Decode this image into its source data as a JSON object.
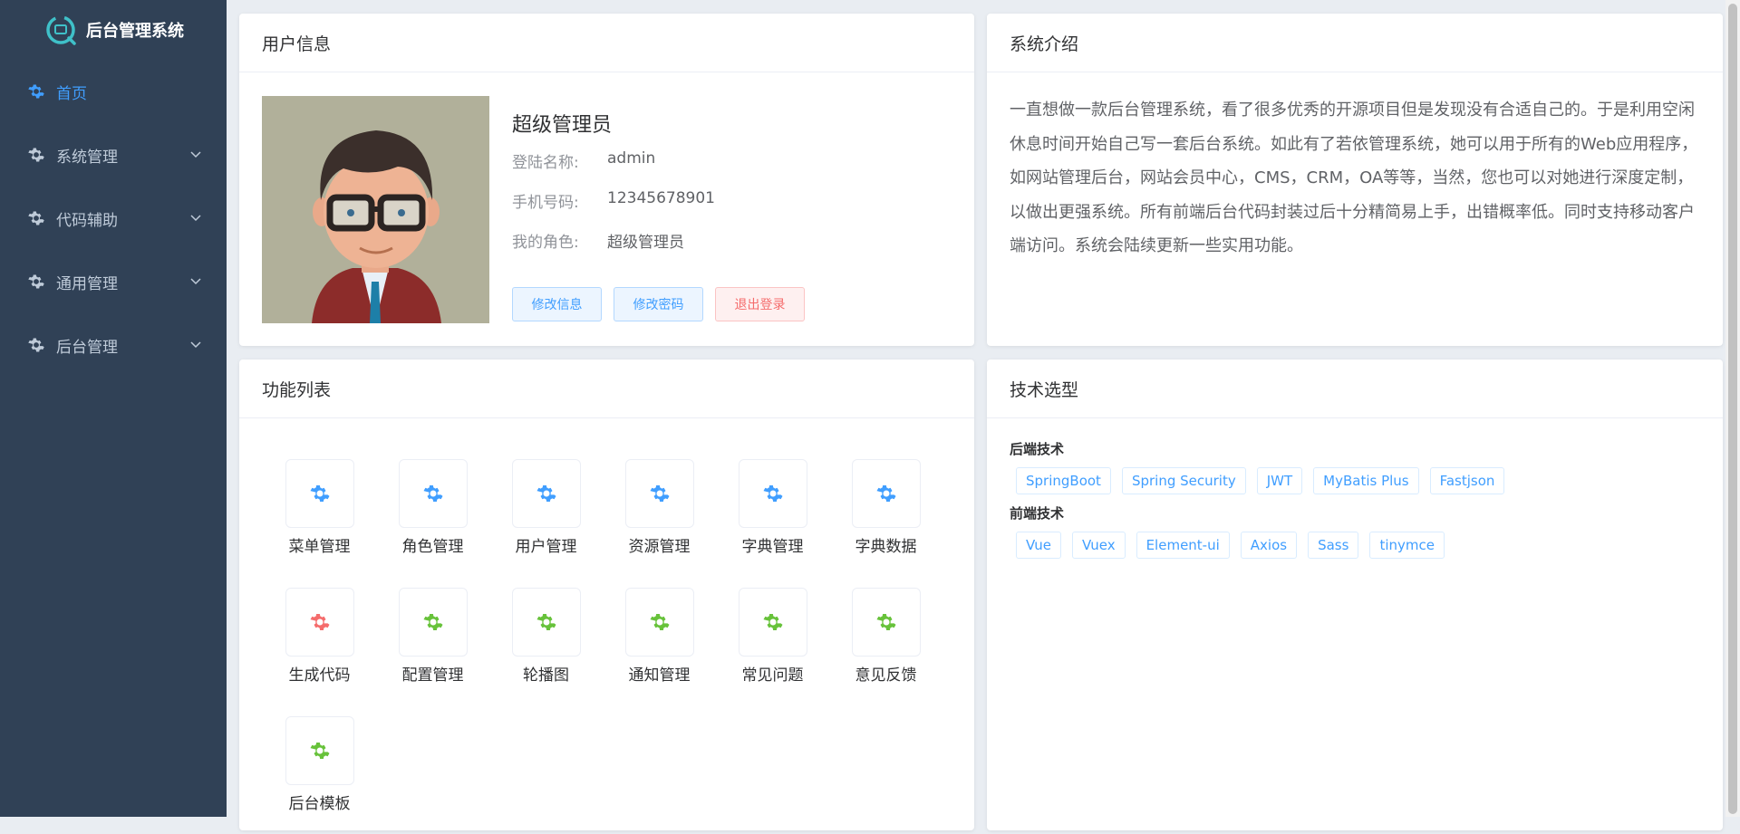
{
  "app": {
    "title": "后台管理系统"
  },
  "sidebar": {
    "items": [
      {
        "label": "首页",
        "active": true,
        "has_children": false
      },
      {
        "label": "系统管理",
        "active": false,
        "has_children": true
      },
      {
        "label": "代码辅助",
        "active": false,
        "has_children": true
      },
      {
        "label": "通用管理",
        "active": false,
        "has_children": true
      },
      {
        "label": "后台管理",
        "active": false,
        "has_children": true
      }
    ]
  },
  "user_card": {
    "title": "用户信息",
    "display_name": "超级管理员",
    "rows": [
      {
        "label": "登陆名称:",
        "value": "admin"
      },
      {
        "label": "手机号码:",
        "value": "12345678901"
      },
      {
        "label": "我的角色:",
        "value": "超级管理员"
      }
    ],
    "buttons": {
      "edit": "修改信息",
      "password": "修改密码",
      "logout": "退出登录"
    }
  },
  "intro_card": {
    "title": "系统介绍",
    "text": "一直想做一款后台管理系统，看了很多优秀的开源项目但是发现没有合适自己的。于是利用空闲休息时间开始自己写一套后台系统。如此有了若依管理系统，她可以用于所有的Web应用程序，如网站管理后台，网站会员中心，CMS，CRM，OA等等，当然，您也可以对她进行深度定制，以做出更强系统。所有前端后台代码封装过后十分精简易上手，出错概率低。同时支持移动客户端访问。系统会陆续更新一些实用功能。"
  },
  "func_card": {
    "title": "功能列表",
    "items": [
      {
        "label": "菜单管理",
        "color": "#409eff"
      },
      {
        "label": "角色管理",
        "color": "#409eff"
      },
      {
        "label": "用户管理",
        "color": "#409eff"
      },
      {
        "label": "资源管理",
        "color": "#409eff"
      },
      {
        "label": "字典管理",
        "color": "#409eff"
      },
      {
        "label": "字典数据",
        "color": "#409eff"
      },
      {
        "label": "生成代码",
        "color": "#f56c6c"
      },
      {
        "label": "配置管理",
        "color": "#67c23a"
      },
      {
        "label": "轮播图",
        "color": "#67c23a"
      },
      {
        "label": "通知管理",
        "color": "#67c23a"
      },
      {
        "label": "常见问题",
        "color": "#67c23a"
      },
      {
        "label": "意见反馈",
        "color": "#67c23a"
      },
      {
        "label": "后台模板",
        "color": "#67c23a"
      }
    ]
  },
  "tech_card": {
    "title": "技术选型",
    "backend_label": "后端技术",
    "backend": [
      "SpringBoot",
      "Spring Security",
      "JWT",
      "MyBatis Plus",
      "Fastjson"
    ],
    "frontend_label": "前端技术",
    "frontend": [
      "Vue",
      "Vuex",
      "Element-ui",
      "Axios",
      "Sass",
      "tinymce"
    ]
  },
  "colors": {
    "sidebar_bg": "#304156",
    "accent": "#409eff",
    "danger": "#f56c6c",
    "success": "#67c23a"
  }
}
